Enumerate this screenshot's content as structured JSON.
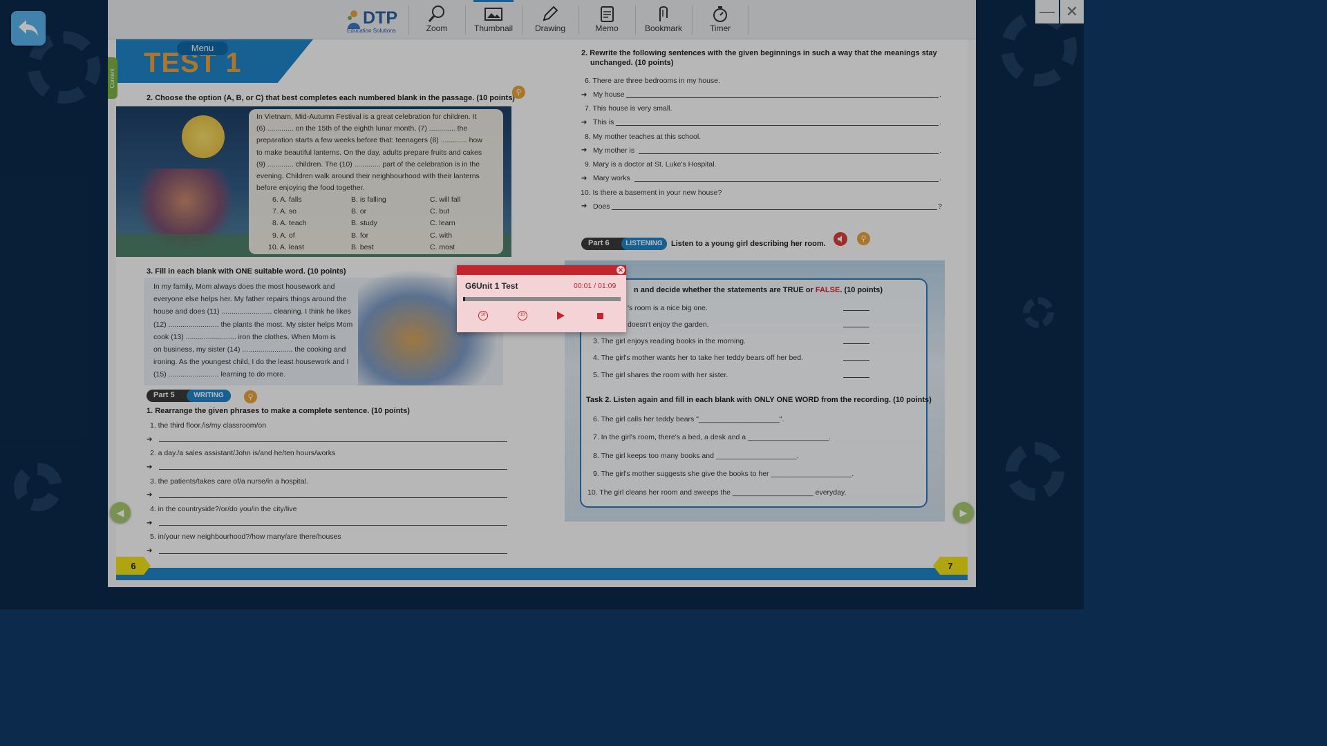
{
  "app": {
    "logo_text": "DTP",
    "logo_sub": "Education Solutions",
    "toolbar": [
      "Zoom",
      "Thumbnail",
      "Drawing",
      "Memo",
      "Bookmark",
      "Timer"
    ],
    "menu_label": "Menu",
    "content_tab": "Content",
    "minimize": "—",
    "close": "✕"
  },
  "left": {
    "test_title": "TEST 1",
    "q2_heading": "2. Choose the option (A, B, or C) that best completes each numbered blank in the passage. (10 points)",
    "passage_lines": [
      "In Vietnam, Mid-Autumn Festival is a great celebration for children. It",
      "(6) ............. on the 15th of the eighth lunar month, (7) ............. the",
      "preparation starts a few weeks before that: teenagers (8) ............. how",
      "to make beautiful lanterns. On the day, adults prepare fruits and cakes",
      "(9) ............. children. The (10) ............. part of the celebration is in the",
      "evening. Children walk around their neighbourhood with their lanterns",
      "before enjoying the food together."
    ],
    "options": [
      [
        "6. A. falls",
        "B. is falling",
        "C. will fall"
      ],
      [
        "7. A. so",
        "B. or",
        "C. but"
      ],
      [
        "8. A. teach",
        "B. study",
        "C. learn"
      ],
      [
        "9. A. of",
        "B. for",
        "C. with"
      ],
      [
        "10. A. least",
        "B. best",
        "C. most"
      ]
    ],
    "q3_heading": "3. Fill in each blank with ONE suitable word. (10 points)",
    "q3_lines": [
      "In my family, Mom always does the most housework and",
      "everyone else helps her. My father repairs things around the",
      "house and does (11) ......................... cleaning. I think he likes",
      "(12) ......................... the plants the most. My sister helps Mom",
      "cook (13) ......................... iron the clothes. When Mom is",
      "on business, my sister (14) ......................... the cooking and",
      "ironing. As the youngest child, I do the least housework and I",
      "(15) ......................... learning to do more."
    ],
    "part5_label": "Part 5",
    "part5_tag": "WRITING",
    "w1_heading": "1. Rearrange the given phrases to make a complete sentence. (10 points)",
    "w_items": [
      "1. the third floor./is/my classroom/on",
      "2. a day./a sales assistant/John is/and he/ten hours/works",
      "3. the patients/takes care of/a nurse/in a hospital.",
      "4. in the countryside?/or/do you/in the city/live",
      "5. in/your new neighbourhood?/how many/are there/houses"
    ],
    "page_number": "6"
  },
  "right": {
    "r2_heading_1": "2. Rewrite the following sentences with the given beginnings in such a way that the meanings stay",
    "r2_heading_2": "unchanged. (10 points)",
    "rewrite": [
      {
        "q": "6. There are three bedrooms in my house.",
        "a": "My house",
        "end": "."
      },
      {
        "q": "7. This house is very small.",
        "a": "This is",
        "end": "."
      },
      {
        "q": "8. My mother teaches at this school.",
        "a": "My mother is",
        "end": "."
      },
      {
        "q": "9. Mary is a doctor at St. Luke's Hospital.",
        "a": "Mary works",
        "end": "."
      },
      {
        "q": "10. Is there a basement in your new house?",
        "a": "Does",
        "end": "?"
      }
    ],
    "part6_label": "Part 6",
    "part6_tag": "LISTENING",
    "part6_heading": "Listen to a young girl describing her room.",
    "task1_pre": "n and decide whether the statements are ",
    "task1_true": "TRUE",
    "task1_or": " or ",
    "task1_false": "FALSE",
    "task1_post": ". (10 points)",
    "task1_items": [
      "'s room is a nice big one.",
      "doesn't enjoy the garden.",
      "3. The girl enjoys reading books in the morning.",
      "4. The girl's mother wants her to take her teddy bears off her bed.",
      "5. The girl shares the room with her sister."
    ],
    "task2_heading": "Task 2. Listen again and fill in each blank with ONLY ONE WORD from the recording. (10 points)",
    "task2_items": [
      "6. The girl calls her teddy bears \"____________________\".",
      "7. In the girl's room, there's a bed, a desk and a ____________________.",
      "8. The girl keeps too many books and ____________________.",
      "9. The girl's mother suggests she give the books to her ____________________.",
      "10. The girl cleans her room and sweeps the ____________________ everyday."
    ],
    "page_number": "7"
  },
  "player": {
    "title": "G6Unit 1 Test",
    "time": "00:01 / 01:09",
    "progress": 0.015,
    "skip_label": "10"
  },
  "colors": {
    "background": "#0c2a4c",
    "accent_blue": "#1f86c8",
    "player_red": "#c2262d",
    "page_number_yellow": "#f2e118",
    "false_red": "#d42a2a"
  }
}
